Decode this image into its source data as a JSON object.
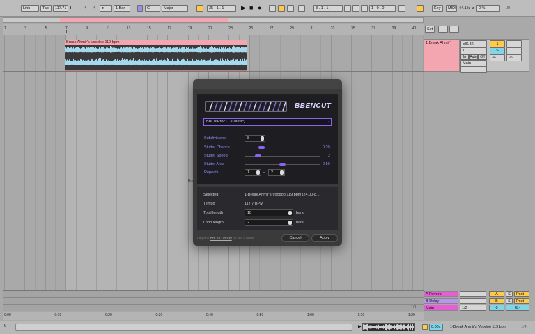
{
  "transport": {
    "link": "Link",
    "tap": "Tap",
    "tempo": "117.71",
    "time_sig_num": "4",
    "time_sig_den": "4",
    "metro": "●",
    "quant": "1 Bar",
    "key": "C",
    "scale": "Major",
    "pos1": "35",
    "pos2": "1",
    "pos3": "1",
    "loop1": "3",
    "loop2": "1",
    "loop3": "1",
    "len1": "1",
    "len2": "0",
    "len3": "0",
    "key_btn": "Key",
    "midi_btn": "MIDI",
    "sample_rate": "44.1 kHz",
    "cpu": "0 %"
  },
  "ruler": {
    "bars": [
      "1",
      "3",
      "5",
      "7",
      "9",
      "11",
      "13",
      "15",
      "17",
      "19",
      "21",
      "23",
      "25",
      "27",
      "29",
      "31",
      "33",
      "35",
      "37",
      "39",
      "41"
    ],
    "set_label": "Set"
  },
  "clip": {
    "name": "Break Ahmir's Voodoo 119 bpm"
  },
  "track": {
    "name": "1 Break Ahmir'",
    "input": "Ext. In",
    "input_channel": "1",
    "routing": "Main",
    "monitor": [
      "In",
      "Auto",
      "Off"
    ],
    "num": "1",
    "s": "S",
    "c": "C",
    "inf1": "-∞",
    "inf2": "-∞"
  },
  "returns": [
    {
      "name": "A Reverb",
      "letter": "A",
      "s": "S",
      "post": "Post"
    },
    {
      "name": "B Delay",
      "letter": "B",
      "s": "S",
      "post": "Post"
    }
  ],
  "main": {
    "name": "Main",
    "value": "1/2",
    "zero": "0",
    "minus": "-5.4"
  },
  "page_counter": "1/1",
  "time_ruler": [
    "0:00",
    "0:10",
    "0:20",
    "0:30",
    "0:40",
    "0:50",
    "1:00",
    "1:10",
    "1:20"
  ],
  "status": {
    "left_indicator": "0",
    "zoom": "0.00x",
    "clip_name": "1-Break Ahmir's Voodoo 119 bpm",
    "right": "1/4"
  },
  "dialog": {
    "logo_text": "BBENCUT",
    "preset": "BBCutProc11 (Classic)",
    "params": [
      {
        "label": "Subdivisions",
        "value": "8",
        "kind": "number"
      },
      {
        "label": "Stutter Chance",
        "value": "0.20",
        "kind": "slider",
        "level": 0.2
      },
      {
        "label": "Stutter Speed",
        "value": "2",
        "kind": "slider",
        "level": 0.15
      },
      {
        "label": "Stutter Area",
        "value": "0.50",
        "kind": "slider",
        "level": 0.5
      },
      {
        "label": "Repeats",
        "value": "1",
        "value2": "2",
        "sep": "–",
        "kind": "range"
      }
    ],
    "selected_label": "Selected",
    "selected_value": "1-Break Ahmir's Voodoo 119 bpm [24.00-8...",
    "tempo_label": "Tempo",
    "tempo_value": "117.7 BPM",
    "total_label": "Total length",
    "total_value": "18",
    "total_unit": "bars",
    "loop_label": "Loop length",
    "loop_value": "2",
    "loop_unit": "bars",
    "footer_prefix": "Original",
    "footer_link": "BBCut Library",
    "footer_suffix": "by Nic Collins",
    "cancel": "Cancel",
    "apply": "Apply"
  },
  "bg_label": "Bre",
  "colors": {
    "clip": "#f4a6b0",
    "track_header": "#f4a6b0",
    "return_a": "#e85cd4",
    "return_b": "#b896f0",
    "main": "#e85cd4",
    "yellow": "#ffc94a",
    "accent_purple": "#8a63f0"
  }
}
